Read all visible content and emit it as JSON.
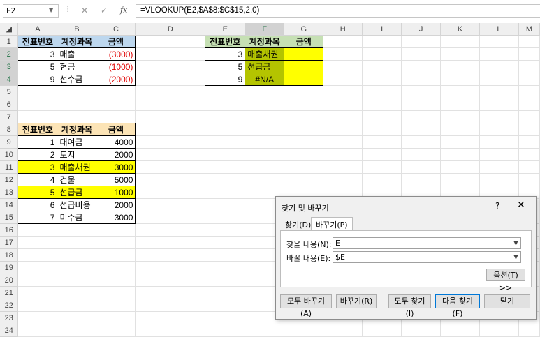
{
  "formula_bar": {
    "name_box": "F2",
    "cancel_glyph": "✕",
    "enter_glyph": "✓",
    "fx_label": "fx",
    "formula": "=VLOOKUP(E2,$A$8:$C$15,2,0)"
  },
  "columns": [
    "A",
    "B",
    "C",
    "D",
    "E",
    "F",
    "G",
    "H",
    "I",
    "J",
    "K",
    "L",
    "M"
  ],
  "rows": [
    "1",
    "2",
    "3",
    "4",
    "5",
    "6",
    "7",
    "8",
    "9",
    "10",
    "11",
    "12",
    "13",
    "14",
    "15",
    "16",
    "17",
    "18",
    "19",
    "20",
    "21",
    "22",
    "23",
    "24"
  ],
  "table1": {
    "headers": [
      "전표번호",
      "계정과목",
      "금액"
    ],
    "rows": [
      {
        "no": "3",
        "acct": "매출",
        "amt": "(3000)"
      },
      {
        "no": "5",
        "acct": "현금",
        "amt": "(1000)"
      },
      {
        "no": "9",
        "acct": "선수금",
        "amt": "(2000)"
      }
    ]
  },
  "table2": {
    "headers": [
      "전표번호",
      "계정과목",
      "금액"
    ],
    "rows": [
      {
        "no": "3",
        "acct": "매출채권",
        "amt": ""
      },
      {
        "no": "5",
        "acct": "선급금",
        "amt": ""
      },
      {
        "no": "9",
        "acct": "#N/A",
        "amt": ""
      }
    ]
  },
  "table3": {
    "headers": [
      "전표번호",
      "계정과목",
      "금액"
    ],
    "rows": [
      {
        "no": "1",
        "acct": "대여금",
        "amt": "4000"
      },
      {
        "no": "2",
        "acct": "토지",
        "amt": "2000"
      },
      {
        "no": "3",
        "acct": "매출채권",
        "amt": "3000"
      },
      {
        "no": "4",
        "acct": "건물",
        "amt": "5000"
      },
      {
        "no": "5",
        "acct": "선급금",
        "amt": "1000"
      },
      {
        "no": "6",
        "acct": "선급비용",
        "amt": "2000"
      },
      {
        "no": "7",
        "acct": "미수금",
        "amt": "3000"
      }
    ]
  },
  "dialog": {
    "title": "찾기 및 바꾸기",
    "help": "?",
    "close": "✕",
    "tab_find": "찾기(D)",
    "tab_replace": "바꾸기(P)",
    "find_label": "찾을 내용(N):",
    "find_value": "E",
    "replace_label": "바꿀 내용(E):",
    "replace_value": "$E",
    "options_button": "옵션(T) >>",
    "replace_all": "모두 바꾸기(A)",
    "replace": "바꾸기(R)",
    "find_all": "모두 찾기(I)",
    "find_next": "다음 찾기(F)",
    "close_button": "닫기"
  },
  "colors": {
    "accent": "#217346",
    "yellow": "#ffff00",
    "olive": "#b4c400",
    "red": "#e00000"
  }
}
